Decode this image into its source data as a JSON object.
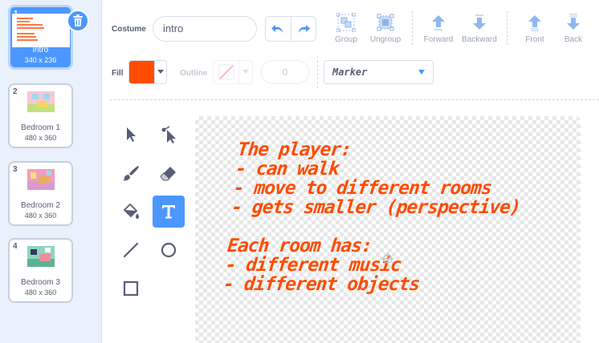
{
  "costumes": [
    {
      "number": "1",
      "name": "intro",
      "size": "340 x 236",
      "selected": true
    },
    {
      "number": "2",
      "name": "Bedroom 1",
      "size": "480 x 360",
      "selected": false
    },
    {
      "number": "3",
      "name": "Bedroom 2",
      "size": "480 x 360",
      "selected": false
    },
    {
      "number": "4",
      "name": "Bedroom 3",
      "size": "480 x 360",
      "selected": false
    }
  ],
  "toolbar": {
    "costume_label": "Costume",
    "costume_name": "intro",
    "group": "Group",
    "ungroup": "Ungroup",
    "forward": "Forward",
    "backward": "Backward",
    "front": "Front",
    "back": "Back",
    "fill_label": "Fill",
    "fill_color": "#ff4c00",
    "outline_label": "Outline",
    "stroke_width": "0",
    "font": "Marker"
  },
  "canvas": {
    "lines": [
      "The player:",
      "- can walk",
      "- move to different rooms",
      "- gets smaller (perspective)",
      "",
      "Each room has:",
      "- different music",
      "- different objects"
    ],
    "text_color": "#ff4c00"
  },
  "colors": {
    "accent": "#4c97ff",
    "text": "#575e75",
    "sidebar_bg": "#e9f1fc"
  }
}
